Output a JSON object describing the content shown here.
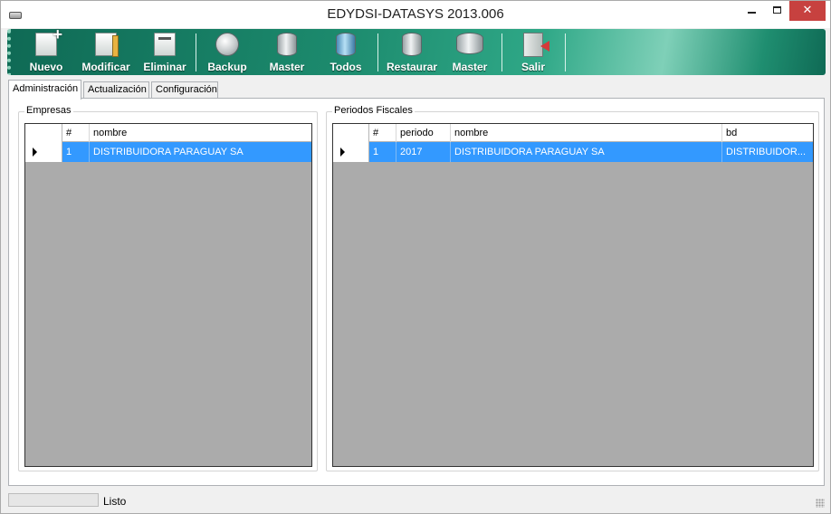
{
  "window": {
    "title": "EDYDSI-DATASYS 2013.006",
    "min_glyph": "",
    "close_glyph": "✕"
  },
  "toolbar": {
    "buttons": [
      {
        "label": "Nuevo",
        "icon": "new-document-icon"
      },
      {
        "label": "Modificar",
        "icon": "edit-document-icon"
      },
      {
        "label": "Eliminar",
        "icon": "delete-document-icon"
      },
      {
        "label": "Backup",
        "icon": "backup-disk-icon"
      },
      {
        "label": "Master",
        "icon": "database-icon"
      },
      {
        "label": "Todos",
        "icon": "database-globe-icon"
      },
      {
        "label": "Restaurar",
        "icon": "restore-database-icon"
      },
      {
        "label": "Master",
        "icon": "database-master-icon"
      },
      {
        "label": "Salir",
        "icon": "exit-door-icon"
      }
    ]
  },
  "tabs": [
    {
      "label": "Administración",
      "active": true
    },
    {
      "label": "Actualización",
      "active": false
    },
    {
      "label": "Configuración",
      "active": false
    }
  ],
  "empresas": {
    "title": "Empresas",
    "columns": [
      "#",
      "nombre"
    ],
    "rows": [
      {
        "num": "1",
        "nombre": "DISTRIBUIDORA PARAGUAY SA",
        "selected": true
      }
    ]
  },
  "periodos": {
    "title": "Periodos Fiscales",
    "columns": [
      "#",
      "periodo",
      "nombre",
      "bd"
    ],
    "rows": [
      {
        "num": "1",
        "periodo": "2017",
        "nombre": "DISTRIBUIDORA PARAGUAY SA",
        "bd": "DISTRIBUIDOR...",
        "selected": true
      }
    ]
  },
  "status": {
    "text": "Listo"
  },
  "colors": {
    "selection": "#3399ff",
    "grid_background": "#ababab",
    "toolbar": "#1c8a6d",
    "close_button": "#c7413f"
  }
}
